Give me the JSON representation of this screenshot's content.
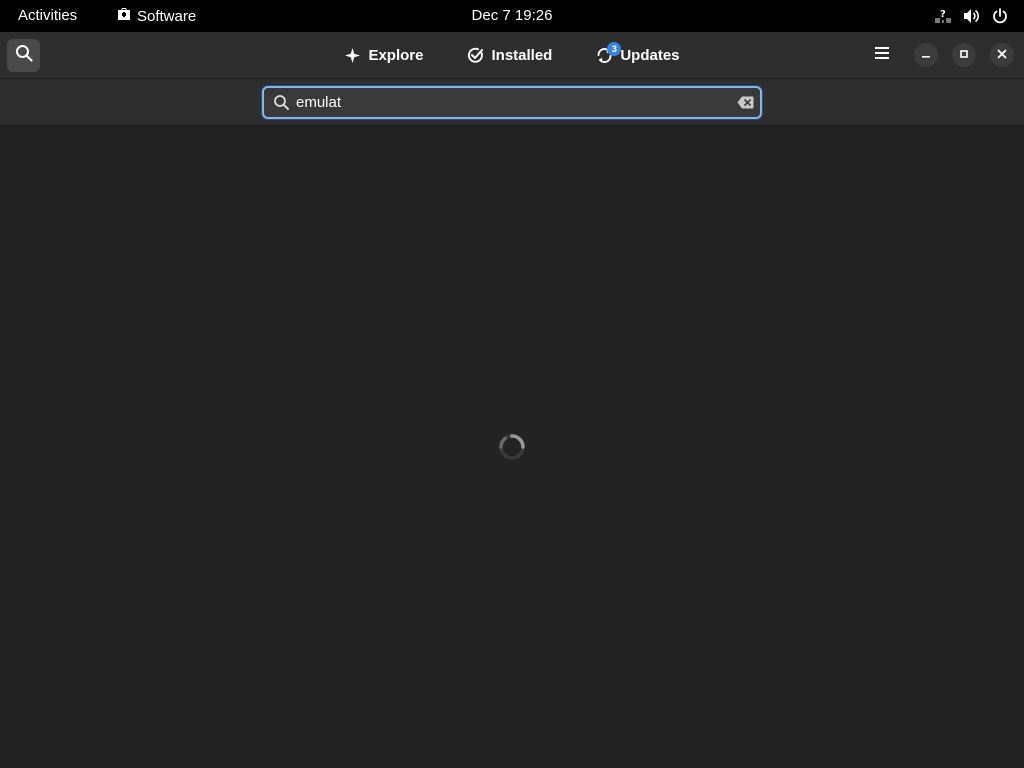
{
  "topbar": {
    "activities": "Activities",
    "app_name": "Software",
    "clock": "Dec 7  19:26",
    "tray_icons": [
      "network-question-icon",
      "volume-icon",
      "power-icon"
    ]
  },
  "header": {
    "tabs": [
      {
        "label": "Explore",
        "icon": "explore-icon"
      },
      {
        "label": "Installed",
        "icon": "installed-check-icon"
      },
      {
        "label": "Updates",
        "icon": "updates-sync-icon",
        "badge": "3"
      }
    ]
  },
  "search": {
    "value": "emulat",
    "placeholder": ""
  },
  "content": {
    "state": "loading"
  },
  "colors": {
    "topbar_bg": "#000000",
    "header_bg": "#2e2e2e",
    "window_bg": "#242424",
    "accent": "#3584e4",
    "focus_ring": "#8ab4e8"
  }
}
